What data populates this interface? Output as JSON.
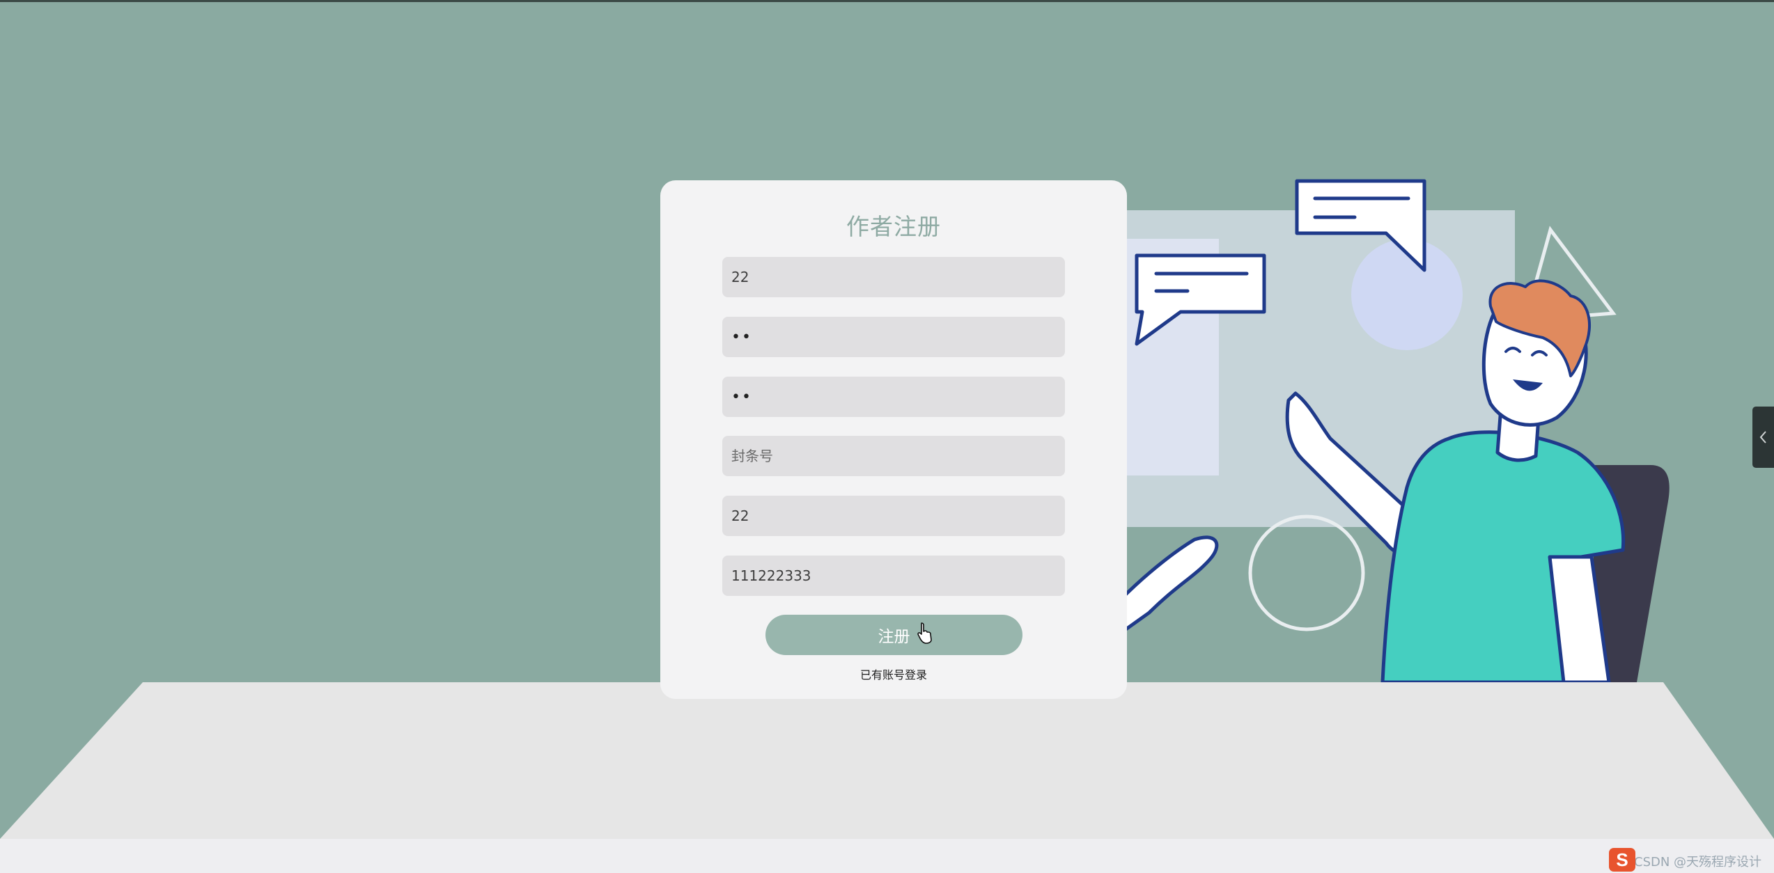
{
  "form": {
    "title": "作者注册",
    "fields": [
      {
        "name": "username",
        "value": "22",
        "placeholder": ""
      },
      {
        "name": "password",
        "value": "••",
        "placeholder": ""
      },
      {
        "name": "confirm-password",
        "value": "••",
        "placeholder": ""
      },
      {
        "name": "cover-id",
        "value": "",
        "placeholder": "封条号"
      },
      {
        "name": "field-5",
        "value": "22",
        "placeholder": ""
      },
      {
        "name": "field-6",
        "value": "111222333",
        "placeholder": ""
      }
    ],
    "submit_label": "注册",
    "login_link": "已有账号登录"
  },
  "watermark": "CSDN @天殇程序设计",
  "colors": {
    "background": "#8aaaa1",
    "card": "#f3f3f4",
    "title": "#8eaaa3",
    "button": "#98b6ad",
    "field": "#e0dfe1",
    "shirt": "#45cfc0",
    "hair": "#e08a5e",
    "outline": "#1f3a8a"
  },
  "icons": [
    "collapse-chevron-icon",
    "sogou-ime-icon",
    "pointer-hand-icon"
  ]
}
